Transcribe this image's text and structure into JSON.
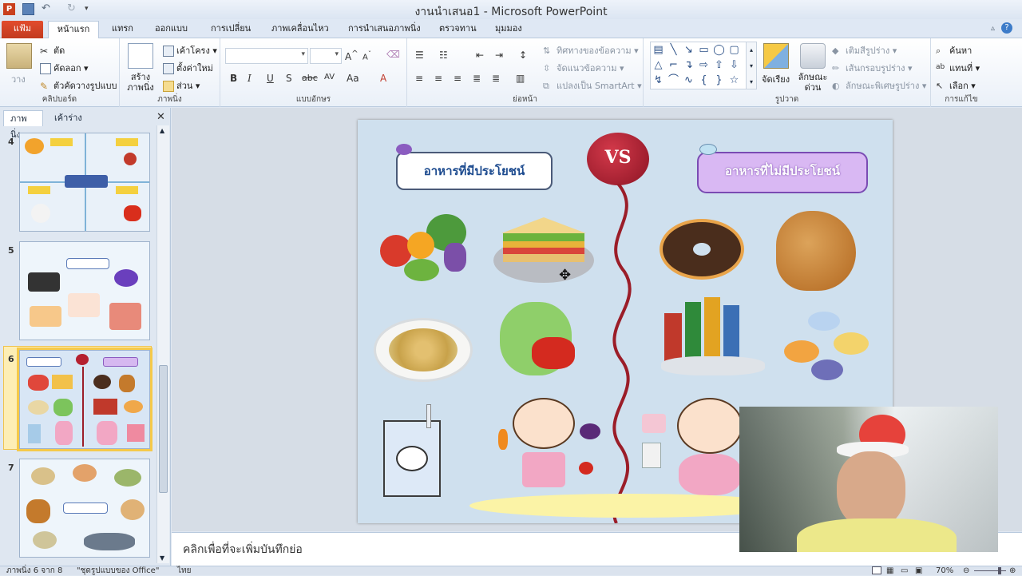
{
  "window": {
    "title": "งานนำเสนอ1 - Microsoft PowerPoint"
  },
  "tabs": [
    {
      "label": "แฟ้ม"
    },
    {
      "label": "หน้าแรก"
    },
    {
      "label": "แทรก"
    },
    {
      "label": "ออกแบบ"
    },
    {
      "label": "การเปลี่ยน"
    },
    {
      "label": "ภาพเคลื่อนไหว"
    },
    {
      "label": "การนำเสนอภาพนิ่ง"
    },
    {
      "label": "ตรวจทาน"
    },
    {
      "label": "มุมมอง"
    }
  ],
  "ribbon": {
    "clipboard": {
      "label": "คลิปบอร์ด",
      "paste": "วาง",
      "cut": "ตัด",
      "copy": "คัดลอก",
      "format_painter": "ตัวคัดวางรูปแบบ"
    },
    "slides": {
      "label": "ภาพนิ่ง",
      "new_slide": "สร้าง ภาพนิ่ง",
      "layout": "เค้าโครง",
      "reset": "ตั้งค่าใหม่",
      "section": "ส่วน"
    },
    "font": {
      "label": "แบบอักษร"
    },
    "paragraph": {
      "label": "ย่อหน้า",
      "text_direction": "ทิศทางของข้อความ",
      "align_text": "จัดแนวข้อความ",
      "smartart": "แปลงเป็น SmartArt"
    },
    "drawing": {
      "label": "รูปวาด",
      "arrange": "จัดเรียง",
      "quick_styles": "ลักษณะ ด่วน",
      "shape_fill": "เติมสีรูปร่าง",
      "shape_outline": "เส้นกรอบรูปร่าง",
      "shape_effects": "ลักษณะพิเศษรูปร่าง"
    },
    "editing": {
      "label": "การแก้ไข",
      "find": "ค้นหา",
      "replace": "แทนที่",
      "select": "เลือก"
    }
  },
  "panel": {
    "tab_slides": "ภาพนิ่ง",
    "tab_outline": "เค้าร่าง",
    "slides": [
      {
        "number": "4"
      },
      {
        "number": "5"
      },
      {
        "number": "6"
      },
      {
        "number": "7"
      }
    ]
  },
  "slide": {
    "left_label": "อาหารที่มีประโยชน์",
    "vs": "VS",
    "right_label": "อาหารที่ไม่มีประโยชน์"
  },
  "notes": {
    "placeholder": "คลิกเพื่อที่จะเพิ่มบันทึกย่อ"
  },
  "status": {
    "slide_info": "ภาพนิ่ง 6 จาก 8",
    "theme": "\"ชุดรูปแบบของ Office\"",
    "language": "ไทย",
    "zoom": "70%"
  },
  "colors": {
    "accent_file_tab": "#c9401f",
    "slide_bg": "#cfe0ee",
    "vs_circle": "#b5202f",
    "selected_thumb": "#f5c94a"
  }
}
